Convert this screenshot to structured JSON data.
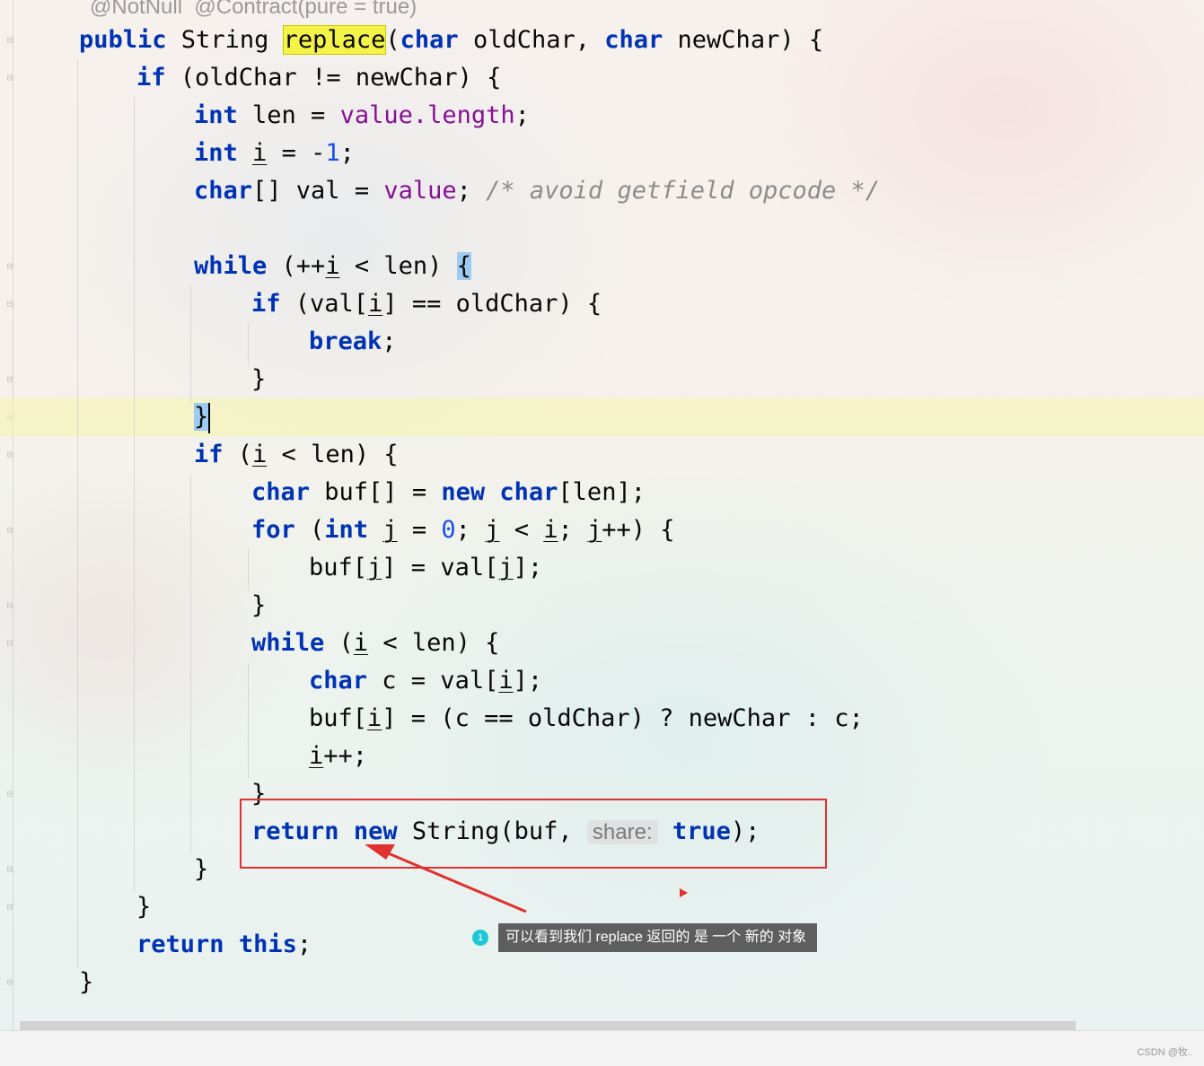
{
  "annotations": "@NotNull  @Contract(pure = true)",
  "code": {
    "l1_kw1": "public",
    "l1_t1": " String ",
    "l1_method": "replace",
    "l1_t2": "(",
    "l1_kw2": "char",
    "l1_t3": " oldChar, ",
    "l1_kw3": "char",
    "l1_t4": " newChar) {",
    "l2_kw": "if",
    "l2_t": " (oldChar != newChar) {",
    "l3_kw": "int",
    "l3_t1": " len = ",
    "l3_f": "value.length",
    "l3_t2": ";",
    "l4_kw": "int",
    "l4_sp": " ",
    "l4_var": "i",
    "l4_t1": " = -",
    "l4_num": "1",
    "l4_t2": ";",
    "l5_kw": "char",
    "l5_t1": "[] val = ",
    "l5_f": "value",
    "l5_t2": "; ",
    "l5_cmt": "/* avoid getfield opcode */",
    "l7_kw": "while",
    "l7_t1": " (++",
    "l7_var": "i",
    "l7_t2": " < len) ",
    "l7_brace": "{",
    "l8_kw": "if",
    "l8_t1": " (val[",
    "l8_var": "i",
    "l8_t2": "] == oldChar) {",
    "l9_kw": "break",
    "l9_t": ";",
    "l10": "}",
    "l11_brace": "}",
    "l12_kw": "if",
    "l12_t1": " (",
    "l12_var": "i",
    "l12_t2": " < len) {",
    "l13_kw1": "char",
    "l13_t1": " buf[] = ",
    "l13_kw2": "new",
    "l13_sp": " ",
    "l13_kw3": "char",
    "l13_t2": "[len];",
    "l14_kw1": "for",
    "l14_t1": " (",
    "l14_kw2": "int",
    "l14_t2": " ",
    "l14_j1": "j",
    "l14_t3": " = ",
    "l14_num": "0",
    "l14_t4": "; ",
    "l14_j2": "j",
    "l14_t5": " < ",
    "l14_i": "i",
    "l14_t6": "; ",
    "l14_j3": "j",
    "l14_t7": "++) {",
    "l15_t1": "buf[",
    "l15_j1": "j",
    "l15_t2": "] = val[",
    "l15_j2": "j",
    "l15_t3": "];",
    "l16": "}",
    "l17_kw": "while",
    "l17_t1": " (",
    "l17_var": "i",
    "l17_t2": " < len) {",
    "l18_kw": "char",
    "l18_t1": " c = val[",
    "l18_var": "i",
    "l18_t2": "];",
    "l19_t1": "buf[",
    "l19_var": "i",
    "l19_t2": "] = (c == oldChar) ? newChar : c;",
    "l20_var": "i",
    "l20_t": "++;",
    "l21": "}",
    "l22_kw1": "return",
    "l22_sp1": " ",
    "l22_kw2": "new",
    "l22_t1": " String(buf, ",
    "l22_hint": "share:",
    "l22_sp2": " ",
    "l22_kw3": "true",
    "l22_t2": ");",
    "l23": "}",
    "l24": "}",
    "l25_kw1": "return",
    "l25_sp": " ",
    "l25_kw2": "this",
    "l25_t": ";",
    "l26": "}"
  },
  "callout": {
    "number": "1",
    "text": "可以看到我们 replace 返回的 是 一个 新的 对象"
  },
  "watermark": "CSDN @牧.."
}
